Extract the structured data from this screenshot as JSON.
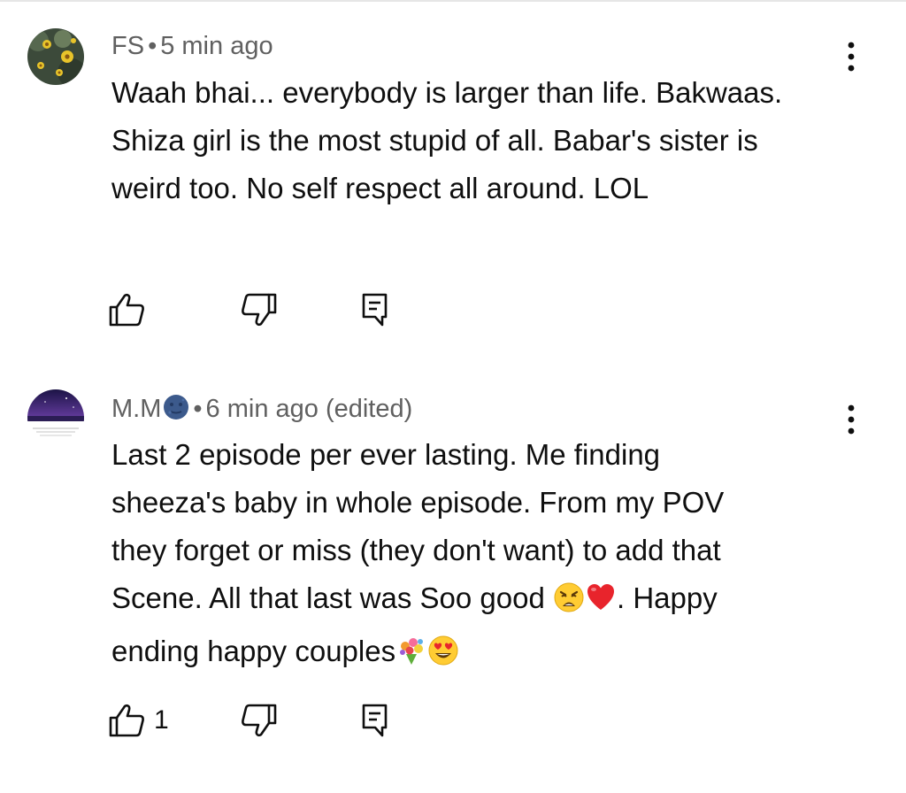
{
  "comments": [
    {
      "author": "FS",
      "separator": "•",
      "time": "5 min ago",
      "text": "Waah bhai... everybody is larger than life. Bakwaas. Shiza girl is the most stupid of all. Babar's sister is weird too. No self respect all around. LOL",
      "like_count": "",
      "avatar_icon": "flower-avatar"
    },
    {
      "author": "M.M",
      "author_emoji": "🌚",
      "separator": "•",
      "time": "6 min ago (edited)",
      "text_lines": [
        "Last 2 episode per ever lasting. Me finding",
        "sheeza's baby in whole episode. From my POV",
        "they forget or miss (they don't want) to add that",
        "Scene. All that last was Soo good ",
        ". Happy",
        "ending happy couples"
      ],
      "emojis": [
        "😩",
        "❤️",
        "💐",
        "😍"
      ],
      "like_count": "1",
      "avatar_icon": "night-scene-avatar"
    }
  ],
  "icons": {
    "like": "thumbs-up-icon",
    "dislike": "thumbs-down-icon",
    "reply": "reply-icon",
    "menu": "more-vert-icon"
  },
  "colors": {
    "meta": "#606060",
    "text": "#0f0f0f"
  }
}
